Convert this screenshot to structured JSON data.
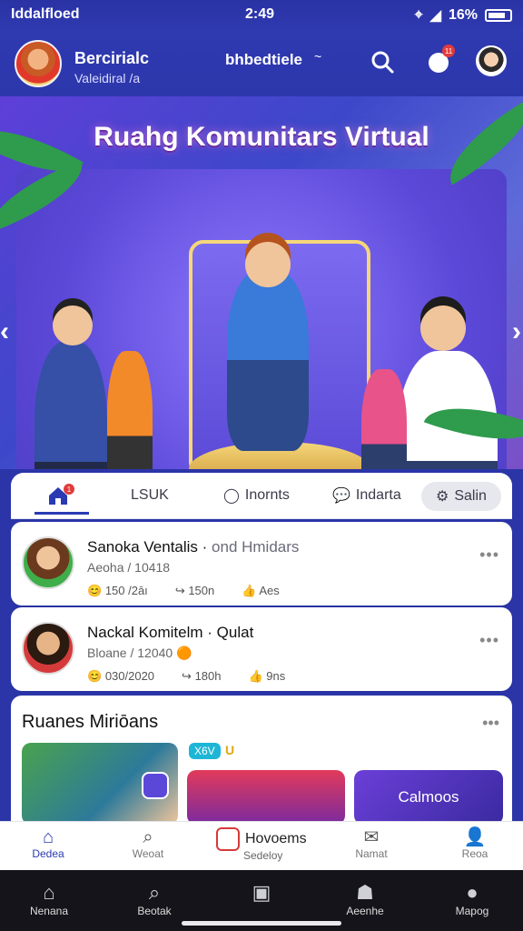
{
  "status_bar": {
    "carrier": "Iddalfloed",
    "time": "2:49",
    "battery": "16%"
  },
  "header": {
    "user_name": "Bercirialc",
    "user_subtitle": "Valeidiral /a",
    "center_title": "bhbedtiele",
    "center_caret": "~",
    "notification_count": "11"
  },
  "hero": {
    "title": "Ruahg Komunitars Virtual"
  },
  "tabs": {
    "home_badge": "1",
    "items": [
      "LSUK",
      "Inornts",
      "Indarta"
    ],
    "settings_label": "Salin"
  },
  "feed": [
    {
      "title": "Sanoka Ventalis",
      "title_muted": "ond Hmidars",
      "subtitle": "Aeoha / 10418",
      "stat_1": "150 /2āı",
      "stat_2": "150n",
      "stat_3": "Aes"
    },
    {
      "title": "Nackal Komitelm",
      "title_muted": "Qulat",
      "subtitle": "Bloane / 12040",
      "stat_1": "030/2020",
      "stat_2": "180h",
      "stat_3": "9ns"
    }
  ],
  "section": {
    "title": "Ruanes Miriōans",
    "tag": "X6V",
    "tag_mark": "U",
    "card_label": "Calmoos"
  },
  "bottom_nav": {
    "items": [
      "Dedea",
      "Weoat",
      "Namat",
      "Reoa"
    ],
    "center_title": "Hovoems",
    "center_sub": "Sedeloy"
  },
  "system_nav": {
    "items": [
      "Nenana",
      "Beotak",
      "Aeenhe",
      "Mapog"
    ]
  },
  "colors": {
    "primary": "#2b35a8",
    "accent": "#2a3ab3",
    "badge": "#e23b3b"
  }
}
